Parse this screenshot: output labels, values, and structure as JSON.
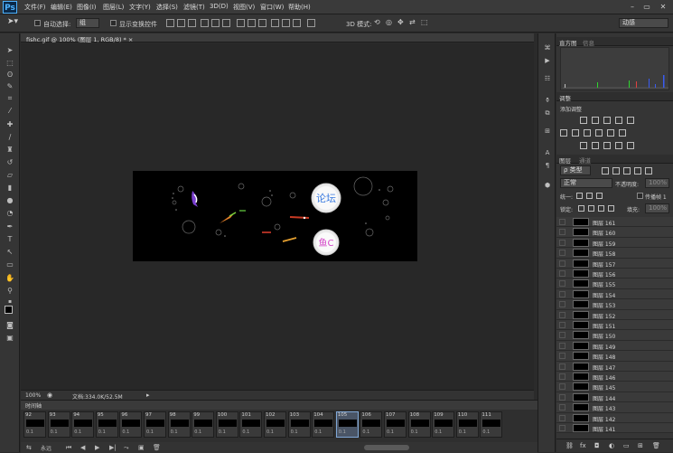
{
  "app": {
    "logo": "Ps"
  },
  "menu": [
    "文件(F)",
    "编辑(E)",
    "图像(I)",
    "图层(L)",
    "文字(Y)",
    "选择(S)",
    "滤镜(T)",
    "3D(D)",
    "视图(V)",
    "窗口(W)",
    "帮助(H)"
  ],
  "window_controls": {
    "minimize": "–",
    "maximize": "▭",
    "close": "✕"
  },
  "options_bar": {
    "auto_select_label": "自动选择:",
    "auto_select_value": "组",
    "show_transform_label": "显示变换控件",
    "mode_3d_label": "3D 模式:",
    "workspace_value": "动感"
  },
  "document": {
    "tab_label": "fishc.gif @ 100% (图层 1, RGB/8) *",
    "close_glyph": "×",
    "bubble1_text": "论坛",
    "bubble2_text": "鱼C"
  },
  "status": {
    "zoom": "100%",
    "doc_info": "文档:334.0K/52.5M"
  },
  "timeline": {
    "title": "时间轴",
    "frames": [
      {
        "num": "92",
        "delay": "0.1"
      },
      {
        "num": "93",
        "delay": "0.1"
      },
      {
        "num": "94",
        "delay": "0.1"
      },
      {
        "num": "95",
        "delay": "0.1"
      },
      {
        "num": "96",
        "delay": "0.1"
      },
      {
        "num": "97",
        "delay": "0.1"
      },
      {
        "num": "98",
        "delay": "0.1"
      },
      {
        "num": "99",
        "delay": "0.1"
      },
      {
        "num": "100",
        "delay": "0.1"
      },
      {
        "num": "101",
        "delay": "0.1"
      },
      {
        "num": "102",
        "delay": "0.1"
      },
      {
        "num": "103",
        "delay": "0.1"
      },
      {
        "num": "104",
        "delay": "0.1"
      },
      {
        "num": "105",
        "delay": "0.1",
        "selected": true
      },
      {
        "num": "106",
        "delay": "0.1"
      },
      {
        "num": "107",
        "delay": "0.1"
      },
      {
        "num": "108",
        "delay": "0.1"
      },
      {
        "num": "109",
        "delay": "0.1"
      },
      {
        "num": "110",
        "delay": "0.1"
      },
      {
        "num": "111",
        "delay": "0.1"
      }
    ],
    "loop_value": "永远",
    "controls": [
      "⏮",
      "◀",
      "▶",
      "▶|",
      "⤳",
      "▣",
      "🗑"
    ]
  },
  "panels": {
    "histogram_tab": "直方图",
    "info_tab": "信息",
    "adjustments_tab": "调整",
    "adjustments_add": "添加调整",
    "layers_tab": "图层",
    "channels_tab": "通道",
    "kind_filter": "ρ 类型",
    "blend_mode": "正常",
    "opacity_label": "不透明度:",
    "opacity_value": "100%",
    "lock_label": "锁定:",
    "propagate_label": "传播帧 1",
    "unify_label": "统一:",
    "fill_label": "填充:",
    "fill_value": "100%",
    "layers": [
      "图层 161",
      "图层 160",
      "图层 159",
      "图层 158",
      "图层 157",
      "图层 156",
      "图层 155",
      "图层 154",
      "图层 153",
      "图层 152",
      "图层 151",
      "图层 150",
      "图层 149",
      "图层 148",
      "图层 147",
      "图层 146",
      "图层 145",
      "图层 144",
      "图层 143",
      "图层 142",
      "图层 141"
    ]
  },
  "colors": {
    "accent": "#4fb3ff",
    "selected_frame": "#7fa7d6"
  }
}
